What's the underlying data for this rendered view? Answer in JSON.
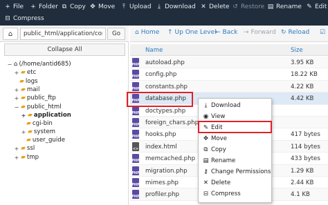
{
  "toolbar": {
    "file": "File",
    "folder": "Folder",
    "copy": "Copy",
    "move": "Move",
    "upload": "Upload",
    "download": "Download",
    "delete": "Delete",
    "restore": "Restore",
    "rename": "Rename",
    "edit": "Edit",
    "compress": "Compress"
  },
  "path": {
    "value": "public_html/application/config",
    "go": "Go"
  },
  "nav": {
    "home": "Home",
    "up": "Up One Level",
    "back": "Back",
    "forward": "Forward",
    "reload": "Reload"
  },
  "tree": {
    "collapse": "Collapse All",
    "items": [
      {
        "label": "(/home/antid685)"
      },
      {
        "label": "etc"
      },
      {
        "label": "logs"
      },
      {
        "label": "mail"
      },
      {
        "label": "public_ftp"
      },
      {
        "label": "public_html"
      },
      {
        "label": "application"
      },
      {
        "label": "cgi-bin"
      },
      {
        "label": "system"
      },
      {
        "label": "user_guide"
      },
      {
        "label": "ssl"
      },
      {
        "label": "tmp"
      }
    ]
  },
  "list": {
    "col_name": "Name",
    "col_size": "Size",
    "files": [
      {
        "name": "autoload.php",
        "size": "3.95 KB"
      },
      {
        "name": "config.php",
        "size": "18.22 KB"
      },
      {
        "name": "constants.php",
        "size": "4.22 KB"
      },
      {
        "name": "database.php",
        "size": "4.42 KB"
      },
      {
        "name": "doctypes.php",
        "size": ""
      },
      {
        "name": "foreign_chars.php",
        "size": ""
      },
      {
        "name": "hooks.php",
        "size": "417 bytes"
      },
      {
        "name": "index.html",
        "size": "114 bytes"
      },
      {
        "name": "memcached.php",
        "size": "433 bytes"
      },
      {
        "name": "migration.php",
        "size": "1.29 KB"
      },
      {
        "name": "mimes.php",
        "size": "2.44 KB"
      },
      {
        "name": "profiler.php",
        "size": "4.1 KB"
      }
    ]
  },
  "context_menu": {
    "items": [
      "Download",
      "View",
      "Edit",
      "Move",
      "Copy",
      "Rename",
      "Change Permissions",
      "Delete",
      "Compress"
    ]
  }
}
